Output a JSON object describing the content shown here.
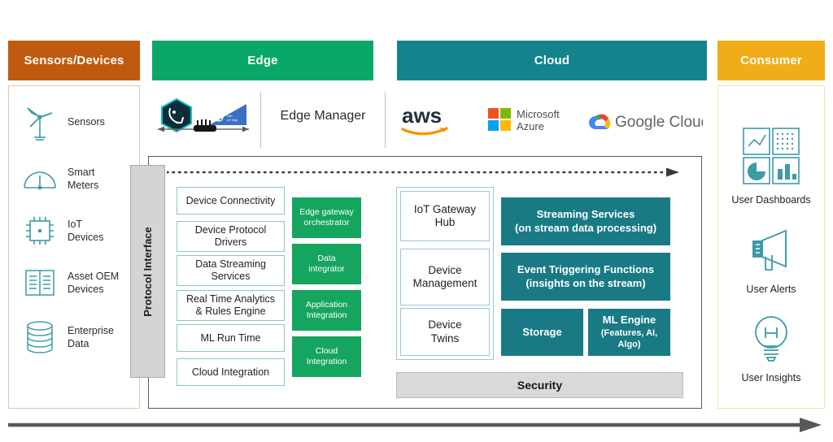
{
  "columns": {
    "sensors": {
      "title": "Sensors/Devices",
      "color": "#c05a11"
    },
    "edge": {
      "title": "Edge",
      "color": "#0aa868"
    },
    "cloud": {
      "title": "Cloud",
      "color": "#14838c"
    },
    "consumer": {
      "title": "Consumer",
      "color": "#f0ad18"
    }
  },
  "sensors_list": [
    {
      "label": "Sensors",
      "icon": "wind-turbine-icon"
    },
    {
      "label": "Smart\nMeters",
      "icon": "gauge-meter-icon"
    },
    {
      "label": "IoT\nDevices",
      "icon": "chip-icon"
    },
    {
      "label": "Asset OEM\nDevices",
      "icon": "open-book-icon"
    },
    {
      "label": "Enterprise\nData",
      "icon": "database-cylinder-icon"
    }
  ],
  "protocol_interface": {
    "label": "Protocol Interface"
  },
  "edge_logos": {
    "items": [
      {
        "name": "edge-hexagon-logo-icon"
      },
      {
        "name": "intel-edge-logo-icon"
      },
      {
        "name": "edge-device-bidirectional-arrow-icon"
      }
    ],
    "manager_label": "Edge Manager"
  },
  "cloud_logos": [
    {
      "name": "aws-logo-icon",
      "label": "aws"
    },
    {
      "name": "microsoft-azure-logo-icon",
      "label": "Microsoft\nAzure"
    },
    {
      "name": "google-cloud-logo-icon",
      "label": "Google Cloud"
    }
  ],
  "flow_arrow": {
    "name": "dotted-flow-arrow",
    "direction": "right"
  },
  "bottom_arrow": {
    "name": "bottom-flow-arrow",
    "direction": "right"
  },
  "edge_stack": [
    "Device Connectivity",
    "Device Protocol\nDrivers",
    "Data Streaming\nServices",
    "Real Time Analytics\n& Rules Engine",
    "ML Run Time",
    "Cloud Integration"
  ],
  "edge_green_stack": [
    "Edge gateway\norchestrator",
    "Data\nintegrator",
    "Application\nIntegration",
    "Cloud\nIntegration"
  ],
  "cloud_gateway_stack": [
    "IoT Gateway\nHub",
    "Device\nManagement",
    "Device\nTwins"
  ],
  "cloud_services": [
    {
      "title": "Streaming Services",
      "subtitle": "(on stream data processing)"
    },
    {
      "title": "Event Triggering Functions",
      "subtitle": "(insights on the stream)"
    },
    {
      "title": "Storage",
      "subtitle": ""
    },
    {
      "title": "ML Engine",
      "subtitle": "(Features, AI,\nAlgo)"
    }
  ],
  "security": {
    "label": "Security"
  },
  "consumer_items": [
    {
      "label": "User Dashboards",
      "icon": "dashboard-grid-icon"
    },
    {
      "label": "User Alerts",
      "icon": "megaphone-icon"
    },
    {
      "label": "User Insights",
      "icon": "lightbulb-icon"
    }
  ]
}
